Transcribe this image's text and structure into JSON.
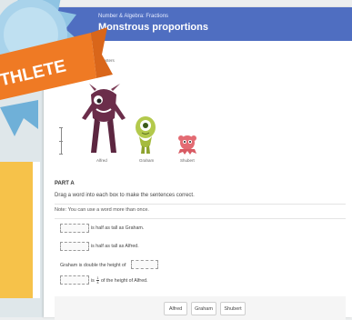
{
  "header": {
    "kicker": "Number & Algebra: Fractions",
    "title": "Monstrous proportions"
  },
  "figure": {
    "partial_label": "onsters",
    "monsters": [
      {
        "name": "Alfred"
      },
      {
        "name": "Graham"
      },
      {
        "name": "Shubert"
      }
    ]
  },
  "part": {
    "label": "PART A",
    "instruction": "Drag a word into each box to make the sentences correct.",
    "note": "Note: You can use a word more than once.",
    "sentences": {
      "s1_text": "is half as tall as Graham.",
      "s2_text": "is half as tall as Alfred.",
      "s3_text": "Graham is double the height of",
      "s4_is": "is",
      "s4_numerator": "1",
      "s4_denominator": "4",
      "s4_text": "of the height of Alfred."
    }
  },
  "word_bank": [
    "Alfred",
    "Graham",
    "Shubert"
  ],
  "badge": {
    "ribbon_text": "THLETE",
    "colors": {
      "seal": "#8fc4e3",
      "ribbon": "#ef7a24"
    }
  }
}
